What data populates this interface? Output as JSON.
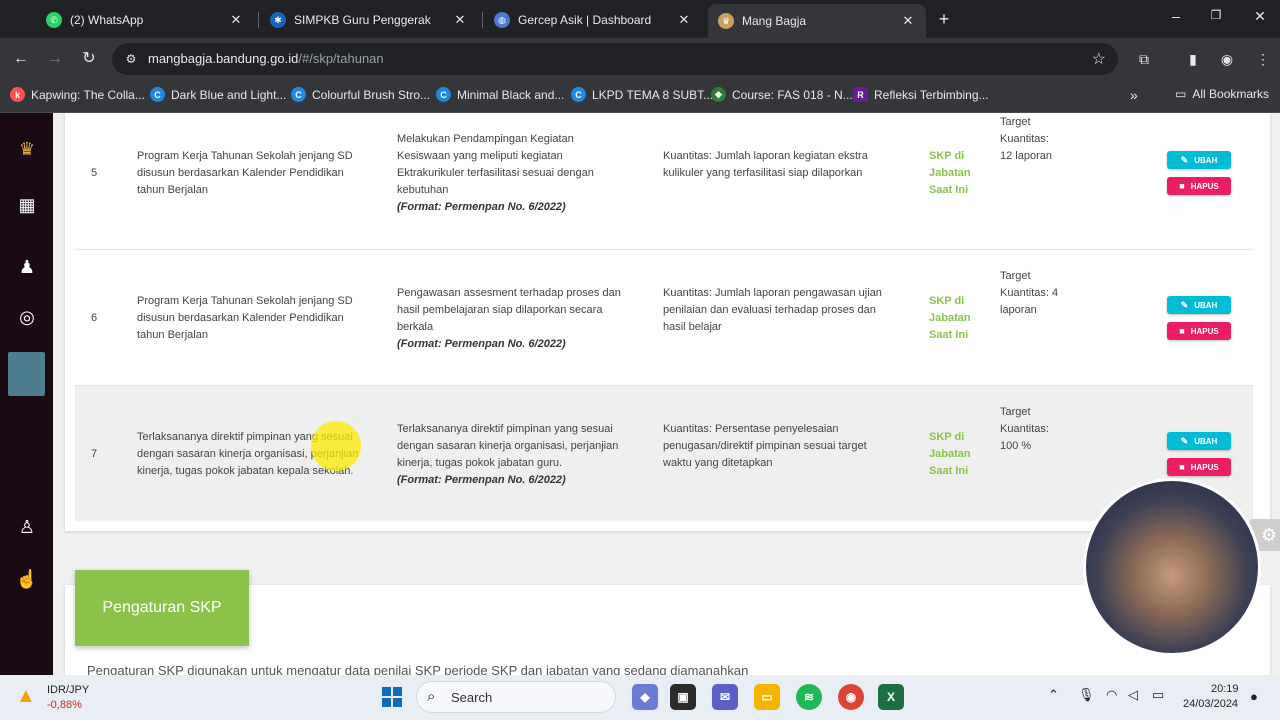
{
  "browser": {
    "tabs": [
      {
        "title": "(2) WhatsApp",
        "icon": "whatsapp-icon",
        "color": "#25d366"
      },
      {
        "title": "SIMPKB Guru Penggerak",
        "icon": "simpkb-icon",
        "color": "#1565c0"
      },
      {
        "title": "Gercep Asik | Dashboard",
        "icon": "globe-icon",
        "color": "#4a7bd0"
      },
      {
        "title": "Mang Bagja",
        "icon": "mangbagja-icon",
        "color": "#c9a15a"
      }
    ],
    "url_host": "mangbagja.bandung.go.id",
    "url_path": "/#/skp/tahunan",
    "bookmarks": [
      {
        "label": "Kapwing: The Colla...",
        "icon": "kapwing-icon",
        "color": "#ff4f4f"
      },
      {
        "label": "Dark Blue and Light...",
        "icon": "canva-icon",
        "color": "#1e88e5"
      },
      {
        "label": "Colourful Brush Stro...",
        "icon": "canva-icon",
        "color": "#1e88e5"
      },
      {
        "label": "Minimal Black and...",
        "icon": "canva-icon",
        "color": "#1e88e5"
      },
      {
        "label": "LKPD TEMA 8 SUBT...",
        "icon": "canva-icon",
        "color": "#1e88e5"
      },
      {
        "label": "Course: FAS 018 - N...",
        "icon": "course-icon",
        "color": "#2e7d32"
      },
      {
        "label": "Refleksi Terbimbing...",
        "icon": "refleksi-icon",
        "color": "#6a1b9a"
      }
    ],
    "all_bookmarks": "All Bookmarks"
  },
  "table": {
    "rows": [
      {
        "no": "5",
        "program": "Program Kerja Tahunan Sekolah jenjang SD disusun berdasarkan Kalender Pendidikan tahun Berjalan",
        "kegiatan": "Melakukan Pendampingan Kegiatan Kesiswaan yang meliputi kegiatan Ektrakurikuler terfasilitasi sesuai dengan kebutuhan",
        "format": "(Format: Permenpan No. 6/2022)",
        "indikator": "Kuantitas: Jumlah laporan kegiatan ekstra kulikuler yang terfasilitasi siap dilaporkan",
        "skp": "SKP di Jabatan Saat Ini",
        "target": "Target Kuantitas: 12 laporan"
      },
      {
        "no": "6",
        "program": "Program Kerja Tahunan Sekolah jenjang SD disusun berdasarkan Kalender Pendidikan tahun Berjalan",
        "kegiatan": "Pengawasan assesment terhadap proses dan hasil pembelajaran siap dilaporkan secara berkala",
        "format": "(Format: Permenpan No. 6/2022)",
        "indikator": "Kuantitas: Jumlah laporan pengawasan ujian penilaian dan evaluasi terhadap proses dan hasil belajar",
        "skp": "SKP di Jabatan Saat Ini",
        "target": "Target Kuantitas: 4 laporan"
      },
      {
        "no": "7",
        "program": "Terlaksananya direktif pimpinan yang sesuai dengan sasaran kinerja organisasi, perjanjian kinerja, tugas pokok jabatan kepala sekolah.",
        "kegiatan": "Terlaksananya direktif pimpinan yang sesuai dengan sasaran kinerja organisasi, perjanjian kinerja, tugas pokok jabatan guru.",
        "format": "(Format: Permenpan No. 6/2022)",
        "indikator": "Kuantitas: Persentase penyelesaian penugasan/direktif pimpinan sesuai target waktu yang ditetapkan",
        "skp": "SKP di Jabatan Saat Ini",
        "target": "Target Kuantitas: 100 %"
      }
    ],
    "ubah_label": "UBAH",
    "hapus_label": "HAPUS"
  },
  "settings": {
    "title": "Pengaturan SKP",
    "description": "Pengaturan SKP digunakan untuk mengatur data penilai SKP periode SKP dan jabatan yang sedang diamanahkan"
  },
  "taskbar": {
    "ticker_label": "IDR/JPY",
    "ticker_value": "-0,88%",
    "search_placeholder": "Search",
    "time": "20:19",
    "date": "24/03/2024"
  },
  "colors": {
    "accent_green": "#8bc34a",
    "ubah": "#00bcd4",
    "hapus": "#e91e63",
    "sidebar": "#1a0a14"
  }
}
